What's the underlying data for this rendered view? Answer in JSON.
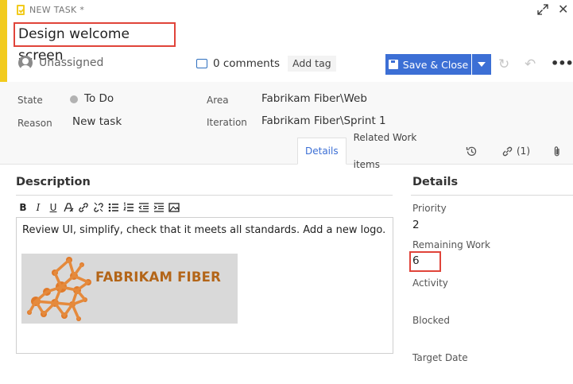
{
  "header": {
    "type_label": "NEW TASK *",
    "title": "Design welcome screen",
    "assigned": "Unassigned",
    "comments": "0 comments",
    "add_tag": "Add tag",
    "save_label": "Save & Close",
    "accent_color": "#f2cb1d",
    "primary_color": "#3c6fd5"
  },
  "fields": {
    "state_label": "State",
    "state_value": "To Do",
    "reason_label": "Reason",
    "reason_value": "New task",
    "area_label": "Area",
    "area_value": "Fabrikam Fiber\\Web",
    "iteration_label": "Iteration",
    "iteration_value": "Fabrikam Fiber\\Sprint 1"
  },
  "tabs": {
    "details": "Details",
    "related": "Related Work items",
    "links_count": "(1)"
  },
  "description": {
    "title": "Description",
    "text": "Review UI, simplify, check that it meets all standards. Add a new logo.",
    "logo_text": "FABRIKAM FIBER"
  },
  "details": {
    "title": "Details",
    "priority_label": "Priority",
    "priority_value": "2",
    "remaining_label": "Remaining Work",
    "remaining_value": "6",
    "activity_label": "Activity",
    "blocked_label": "Blocked",
    "target_label": "Target Date"
  },
  "toolbar": {
    "bold": "B",
    "italic": "I",
    "underline": "U"
  }
}
